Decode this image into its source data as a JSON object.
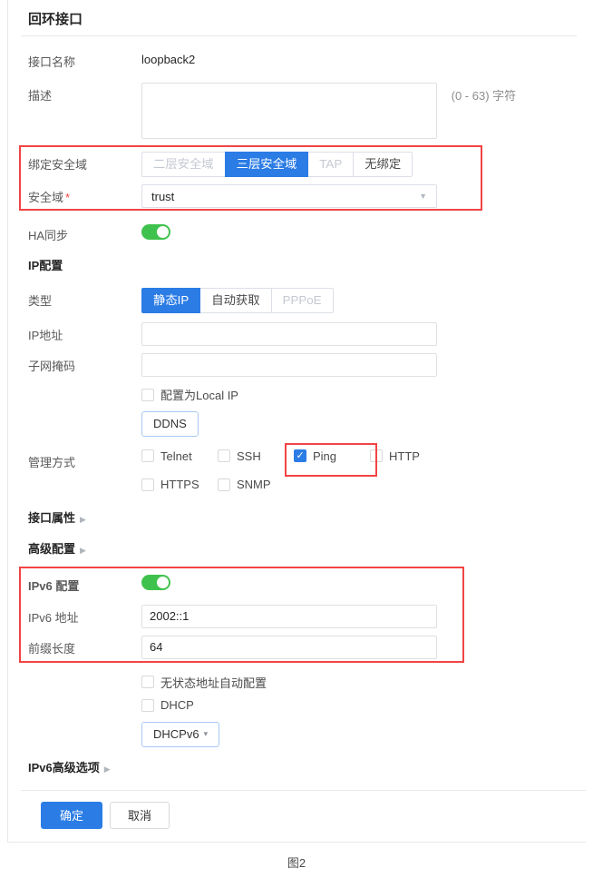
{
  "page": {
    "title": "回环接口",
    "caption": "图2"
  },
  "form": {
    "interface_name": {
      "label": "接口名称",
      "value": "loopback2"
    },
    "description": {
      "label": "描述",
      "value": "",
      "hint": "(0 - 63) 字符"
    },
    "bind_zone": {
      "label": "绑定安全域",
      "options": [
        {
          "label": "二层安全域",
          "state": "disabled"
        },
        {
          "label": "三层安全域",
          "state": "selected"
        },
        {
          "label": "TAP",
          "state": "disabled"
        },
        {
          "label": "无绑定",
          "state": "normal"
        }
      ]
    },
    "security_zone": {
      "label": "安全域",
      "required_mark": "*",
      "value": "trust"
    },
    "ha_sync": {
      "label": "HA同步",
      "state": "on"
    },
    "ip_section_title": "IP配置",
    "ip_type": {
      "label": "类型",
      "options": [
        {
          "label": "静态IP",
          "state": "selected"
        },
        {
          "label": "自动获取",
          "state": "normal"
        },
        {
          "label": "PPPoE",
          "state": "disabled"
        }
      ]
    },
    "ip_address": {
      "label": "IP地址",
      "value": ""
    },
    "subnet_mask": {
      "label": "子网掩码",
      "value": ""
    },
    "local_ip_checkbox": {
      "label": "配置为Local IP",
      "checked": false
    },
    "ddns_button": {
      "label": "DDNS"
    },
    "management": {
      "label": "管理方式",
      "row1": [
        {
          "label": "Telnet",
          "checked": false
        },
        {
          "label": "SSH",
          "checked": false
        },
        {
          "label": "Ping",
          "checked": true,
          "highlighted": true
        },
        {
          "label": "HTTP",
          "checked": false
        }
      ],
      "row2": [
        {
          "label": "HTTPS",
          "checked": false
        },
        {
          "label": "SNMP",
          "checked": false
        }
      ]
    },
    "interface_props": {
      "label": "接口属性"
    },
    "advanced_config": {
      "label": "高级配置"
    },
    "ipv6": {
      "toggle_label": "IPv6 配置",
      "state": "on",
      "address": {
        "label": "IPv6 地址",
        "value": "2002::1"
      },
      "prefix": {
        "label": "前缀长度",
        "value": "64"
      }
    },
    "slaac_checkbox": {
      "label": "无状态地址自动配置",
      "checked": false
    },
    "dhcp_checkbox": {
      "label": "DHCP",
      "checked": false
    },
    "dhcpv6_button": {
      "label": "DHCPv6"
    },
    "ipv6_advanced": {
      "label": "IPv6高级选项"
    },
    "ok_button": "确定",
    "cancel_button": "取消"
  },
  "colors": {
    "primary_blue": "#2b7ce5",
    "toggle_green": "#3fc24d",
    "annotation_red": "#f24444"
  }
}
